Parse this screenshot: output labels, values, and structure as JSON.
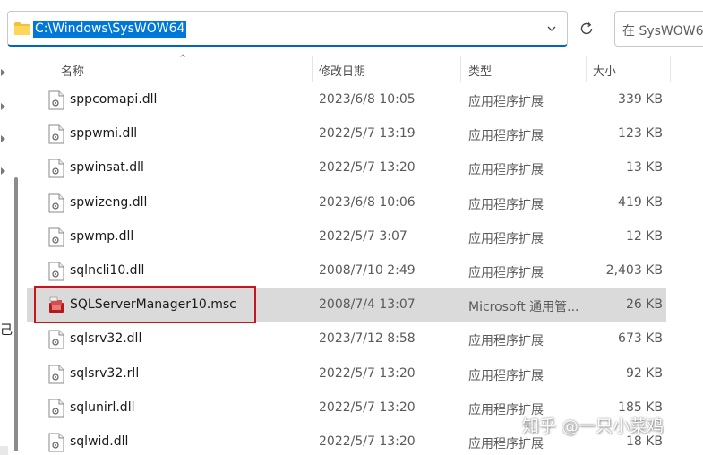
{
  "address_bar": {
    "path": "C:\\Windows\\SysWOW64"
  },
  "search": {
    "placeholder": "在 SysWOW64 中搜索"
  },
  "nav_pane": {
    "partial_text": "己"
  },
  "columns": {
    "name": "名称",
    "date": "修改日期",
    "type": "类型",
    "size": "大小"
  },
  "files": [
    {
      "name": "sppcomapi.dll",
      "date": "2023/6/8 10:05",
      "type": "应用程序扩展",
      "size": "339 KB",
      "icon": "dll-file-icon"
    },
    {
      "name": "sppwmi.dll",
      "date": "2022/5/7 13:19",
      "type": "应用程序扩展",
      "size": "123 KB",
      "icon": "dll-file-icon"
    },
    {
      "name": "spwinsat.dll",
      "date": "2022/5/7 13:20",
      "type": "应用程序扩展",
      "size": "13 KB",
      "icon": "dll-file-icon"
    },
    {
      "name": "spwizeng.dll",
      "date": "2023/6/8 10:06",
      "type": "应用程序扩展",
      "size": "419 KB",
      "icon": "dll-file-icon"
    },
    {
      "name": "spwmp.dll",
      "date": "2022/5/7 3:07",
      "type": "应用程序扩展",
      "size": "12 KB",
      "icon": "dll-file-icon"
    },
    {
      "name": "sqlncli10.dll",
      "date": "2008/7/10 2:49",
      "type": "应用程序扩展",
      "size": "2,403 KB",
      "icon": "dll-file-icon"
    },
    {
      "name": "SQLServerManager10.msc",
      "date": "2008/7/4 13:07",
      "type": "Microsoft 通用管...",
      "size": "26 KB",
      "icon": "msc-console-icon",
      "selected": true
    },
    {
      "name": "sqlsrv32.dll",
      "date": "2023/7/12 8:58",
      "type": "应用程序扩展",
      "size": "673 KB",
      "icon": "dll-file-icon"
    },
    {
      "name": "sqlsrv32.rll",
      "date": "2022/5/7 13:20",
      "type": "应用程序扩展",
      "size": "92 KB",
      "icon": "dll-file-icon"
    },
    {
      "name": "sqlunirl.dll",
      "date": "2022/5/7 13:20",
      "type": "应用程序扩展",
      "size": "185 KB",
      "icon": "dll-file-icon"
    },
    {
      "name": "sqlwid.dll",
      "date": "2022/5/7 13:20",
      "type": "应用程序扩展",
      "size": "18 KB",
      "icon": "dll-file-icon"
    }
  ],
  "watermark": "知乎 @一只小菜鸡",
  "colors": {
    "selection": "#0078d7",
    "highlight_border": "#c4161c",
    "row_selected": "#dadada"
  }
}
